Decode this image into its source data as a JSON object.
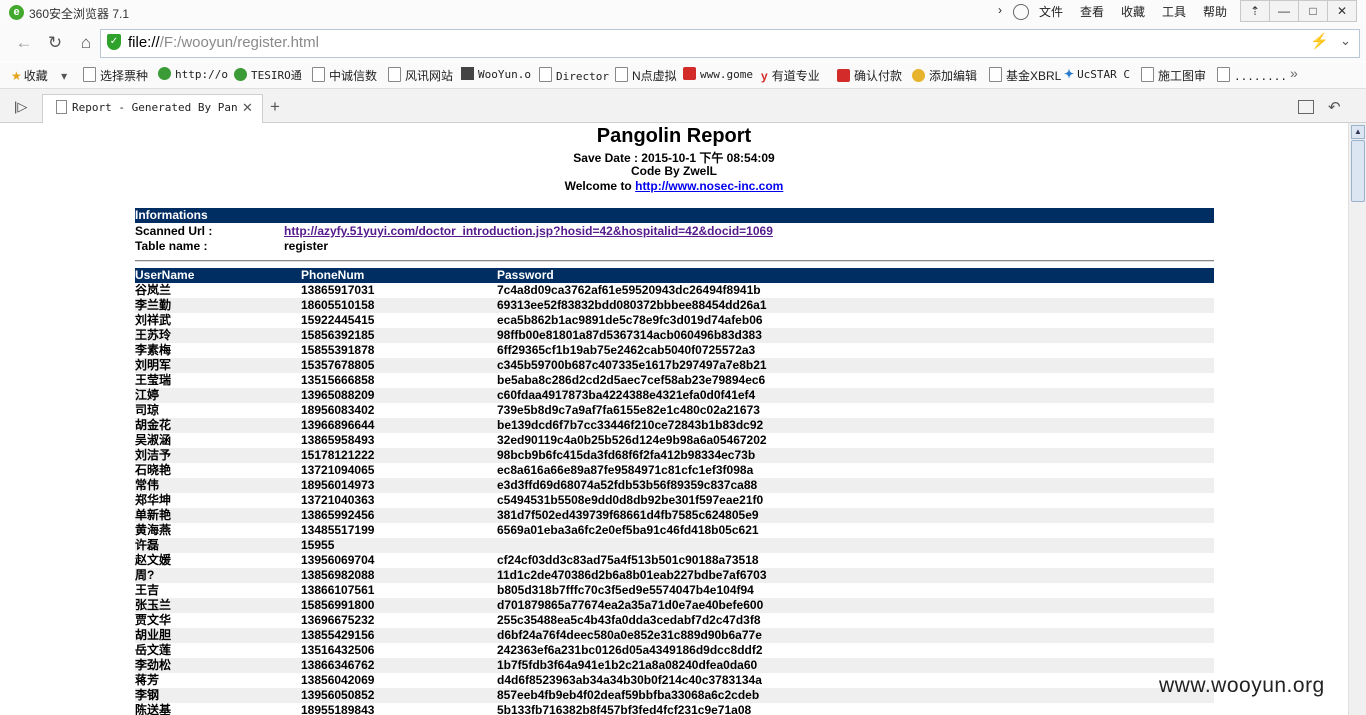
{
  "window": {
    "title": "360安全浏览器 7.1",
    "menu": [
      "文件",
      "查看",
      "收藏",
      "工具",
      "帮助"
    ],
    "controls": [
      "⇡",
      "—",
      "□",
      "✕"
    ]
  },
  "address": {
    "prefix": "file://",
    "path": "/F:/wooyun/register.html"
  },
  "bookmarks": [
    {
      "label": "收藏",
      "icon": "star-icon"
    },
    {
      "label": "选择票种",
      "icon": "page-icon"
    },
    {
      "label": "http://o",
      "icon": "gear-icon"
    },
    {
      "label": "TESIRO通",
      "icon": "gear-icon"
    },
    {
      "label": "中诚信数",
      "icon": "page-icon"
    },
    {
      "label": "风讯网站",
      "icon": "page-icon"
    },
    {
      "label": "WooYun.o",
      "icon": "wooyun-icon"
    },
    {
      "label": "Director",
      "icon": "page-icon"
    },
    {
      "label": "N点虚拟",
      "icon": "page-icon"
    },
    {
      "label": "www.gome",
      "icon": "gome-icon"
    },
    {
      "label": "有道专业",
      "icon": "youdao-icon"
    },
    {
      "label": "确认付款",
      "icon": "s-icon"
    },
    {
      "label": "添加编辑",
      "icon": "ie-icon"
    },
    {
      "label": "基金XBRL",
      "icon": "page-icon"
    },
    {
      "label": "UcSTAR C",
      "icon": "ucstar-icon"
    },
    {
      "label": "施工图审",
      "icon": "page-icon"
    },
    {
      "label": "........",
      "icon": "page-icon"
    }
  ],
  "tab": {
    "label": "Report - Generated By Pangolin"
  },
  "report": {
    "title": "Pangolin Report",
    "save_date": "Save Date : 2015-10-1 下午 08:54:09",
    "code_by": "Code By ZwelL",
    "welcome_prefix": "Welcome to ",
    "welcome_link": "http://www.nosec-inc.com",
    "info_header": "Informations",
    "scanned_url_label": "Scanned Url :",
    "scanned_url": "http://azyfy.51yuyi.com/doctor_introduction.jsp?hosid=42&hospitalid=42&docid=1069",
    "table_name_label": "Table name :",
    "table_name": "register",
    "columns": [
      "UserName",
      "PhoneNum",
      "Password"
    ],
    "rows": [
      [
        "谷岚兰",
        "13865917031",
        "7c4a8d09ca3762af61e59520943dc26494f8941b"
      ],
      [
        "李兰勤",
        "18605510158",
        "69313ee52f83832bdd080372bbbee88454dd26a1"
      ],
      [
        "刘祥武",
        "15922445415",
        "eca5b862b1ac9891de5c78e9fc3d019d74afeb06"
      ],
      [
        "王苏玲",
        "15856392185",
        "98ffb00e81801a87d5367314acb060496b83d383"
      ],
      [
        "李素梅",
        "15855391878",
        "6ff29365cf1b19ab75e2462cab5040f0725572a3"
      ],
      [
        "刘明军",
        "15357678805",
        "c345b59700b687c407335e1617b297497a7e8b21"
      ],
      [
        "王莹瑞",
        "13515666858",
        "be5aba8c286d2cd2d5aec7cef58ab23e79894ec6"
      ],
      [
        "江婷",
        "13965088209",
        "c60fdaa4917873ba4224388e4321efa0d0f41ef4"
      ],
      [
        "司琼",
        "18956083402",
        "739e5b8d9c7a9af7fa6155e82e1c480c02a21673"
      ],
      [
        "胡金花",
        "13966896644",
        "be139dcd6f7b7cc33446f210ce72843b1b83dc92"
      ],
      [
        "吴淑涵",
        "13865958493",
        "32ed90119c4a0b25b526d124e9b98a6a05467202"
      ],
      [
        "刘洁予",
        "15178121222",
        "98bcb9b6fc415da3fd68f6f2fa412b98334ec73b"
      ],
      [
        "石晓艳",
        "13721094065",
        "ec8a616a66e89a87fe9584971c81cfc1ef3f098a"
      ],
      [
        "常伟",
        "18956014973",
        "e3d3ffd69d68074a52fdb53b56f89359c837ca88"
      ],
      [
        "郑华坤",
        "13721040363",
        "c5494531b5508e9dd0d8db92be301f597eae21f0"
      ],
      [
        "单新艳",
        "13865992456",
        "381d7f502ed439739f68661d4fb7585c624805e9"
      ],
      [
        "黄海燕",
        "13485517199",
        "6569a01eba3a6fc2e0ef5ba91c46fd418b05c621"
      ],
      [
        "许磊",
        "15955",
        ""
      ],
      [
        "赵文媛",
        "13956069704",
        "cf24cf03dd3c83ad75a4f513b501c90188a73518"
      ],
      [
        "周?",
        "13856982088",
        "11d1c2de470386d2b6a8b01eab227bdbe7af6703"
      ],
      [
        "王吉",
        "13866107561",
        "b805d318b7fffc70c3f5ed9e5574047b4e104f94"
      ],
      [
        "张玉兰",
        "15856991800",
        "d701879865a77674ea2a35a71d0e7ae40befe600"
      ],
      [
        "贾文华",
        "13696675232",
        "255c35488ea5c4b43fa0dda3cedabf7d2c47d3f8"
      ],
      [
        "胡业胆",
        "13855429156",
        "d6bf24a76f4deec580a0e852e31c889d90b6a77e"
      ],
      [
        "岳文莲",
        "13516432506",
        "242363ef6a231bc0126d05a4349186d9dcc8ddf2"
      ],
      [
        "李劲松",
        "13866346762",
        "1b7f5fdb3f64a941e1b2c21a8a08240dfea0da60"
      ],
      [
        "蒋芳",
        "13856042069",
        "d4d6f8523963ab34a34b30b0f214c40c3783134a"
      ],
      [
        "李钢",
        "13956050852",
        "857eeb4fb9eb4f02deaf59bbfba33068a6c2cdeb"
      ],
      [
        "陈送基",
        "18955189843",
        "5b133fb716382b8f457bf3fed4fcf231c9e71a08"
      ]
    ]
  },
  "watermark": "www.wooyun.org"
}
